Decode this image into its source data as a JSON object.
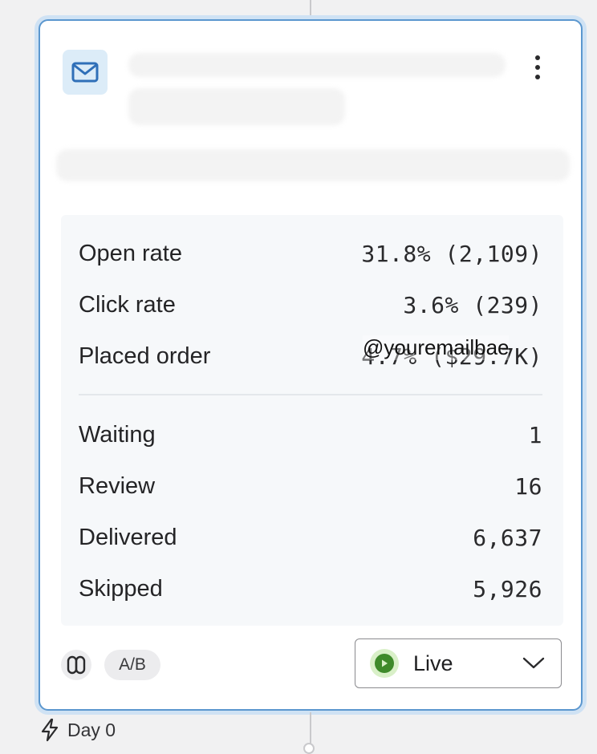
{
  "card": {
    "icon": "mail-icon",
    "menu_icon": "kebab-menu-icon"
  },
  "stats": {
    "performance": [
      {
        "label": "Open rate",
        "value": "31.8% (2,109)"
      },
      {
        "label": "Click rate",
        "value": "3.6% (239)"
      },
      {
        "label": "Placed order",
        "value": "4.7% ($29.7K)"
      }
    ],
    "counts": [
      {
        "label": "Waiting",
        "value": "1"
      },
      {
        "label": "Review",
        "value": "16"
      },
      {
        "label": "Delivered",
        "value": "6,637"
      },
      {
        "label": "Skipped",
        "value": "5,926"
      }
    ]
  },
  "watermark": "@youremailbae",
  "footer": {
    "link_icon": "link-icon",
    "ab_label": "A/B",
    "status": {
      "label": "Live",
      "icon": "play-circle-icon",
      "color": "#3e8a2a",
      "chevron": "chevron-down-icon"
    }
  },
  "trigger": {
    "icon": "lightning-icon",
    "label": "Day 0"
  },
  "colors": {
    "accent_border": "#5b97cf",
    "icon_bg": "#dcecf8",
    "live_green": "#3e8a2a"
  }
}
